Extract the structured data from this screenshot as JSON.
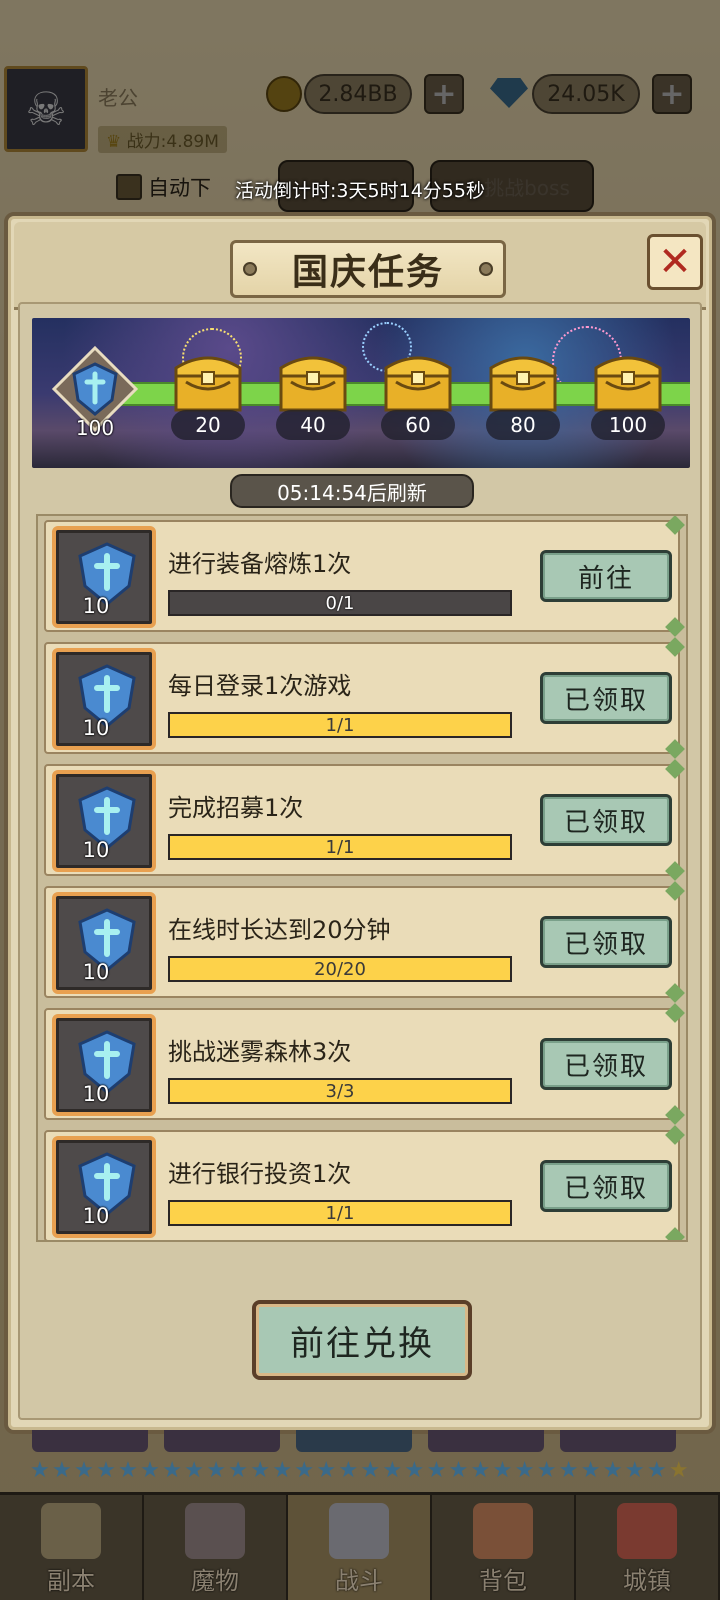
{
  "background": {
    "player": {
      "name": "老公",
      "power": "战力:4.89M"
    },
    "resources": {
      "gold": "2.84BB",
      "gems": "24.05K"
    },
    "auto_label": "自动下",
    "challenge_boss_label": "挑战boss",
    "event_countdown": "活动倒计时:3天5时14分55秒"
  },
  "panel": {
    "title": "国庆任务",
    "close_label": "✕",
    "reward_track": {
      "current_points": "100",
      "milestones": [
        "20",
        "40",
        "60",
        "80",
        "100"
      ]
    },
    "refresh_text": "05:14:54后刷新",
    "tasks": [
      {
        "title": "进行装备熔炼1次",
        "reward": "10",
        "progress_text": "0/1",
        "progress": 0,
        "button": "前往"
      },
      {
        "title": "每日登录1次游戏",
        "reward": "10",
        "progress_text": "1/1",
        "progress": 1,
        "button": "已领取"
      },
      {
        "title": "完成招募1次",
        "reward": "10",
        "progress_text": "1/1",
        "progress": 1,
        "button": "已领取"
      },
      {
        "title": "在线时长达到20分钟",
        "reward": "10",
        "progress_text": "20/20",
        "progress": 1,
        "button": "已领取"
      },
      {
        "title": "挑战迷雾森林3次",
        "reward": "10",
        "progress_text": "3/3",
        "progress": 1,
        "button": "已领取"
      },
      {
        "title": "进行银行投资1次",
        "reward": "10",
        "progress_text": "1/1",
        "progress": 1,
        "button": "已领取"
      }
    ],
    "exchange_button": "前往兑换"
  },
  "nav": {
    "items": [
      {
        "label": "副本",
        "icon": "map-scroll-icon"
      },
      {
        "label": "魔物",
        "icon": "monster-helmet-icon"
      },
      {
        "label": "战斗",
        "icon": "crossed-swords-icon"
      },
      {
        "label": "背包",
        "icon": "backpack-icon"
      },
      {
        "label": "城镇",
        "icon": "town-building-icon"
      }
    ],
    "active_index": 2
  },
  "colors": {
    "progress_fill": "#fdd24a",
    "button_green": "#a8c8b4",
    "reward_track": "#7dd44a",
    "close_red": "#b02a20"
  }
}
